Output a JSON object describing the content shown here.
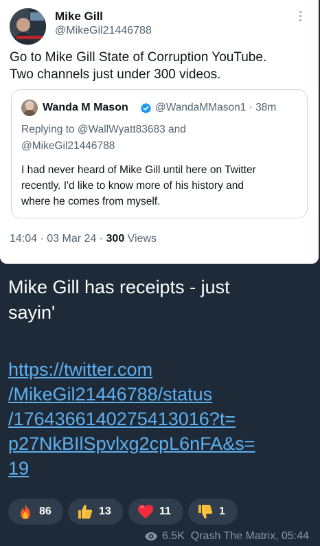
{
  "tweet": {
    "author_name": "Mike Gill",
    "author_handle": "@MikeGil21446788",
    "text_lines": [
      "Go to Mike Gill State of Corruption YouTube.",
      "Two channels just under 300 videos."
    ],
    "quote": {
      "name": "Wanda M Mason",
      "handle_time": "@WandaMMason1 · 38m",
      "reply_line1": "Replying to @WallWyatt83683 and",
      "reply_line2": "@MikeGil21446788",
      "body_lines": [
        "I had never heard of Mike Gill until here on Twitter",
        "recently. I'd like to know more of his history and",
        "where he comes from myself."
      ]
    },
    "time": "14:04 · 03 Mar 24 · ",
    "views_count": "300",
    "views_label": " Views"
  },
  "message": {
    "text_lines": [
      "Mike Gill has receipts - just",
      "sayin'"
    ],
    "link_lines": [
      "https://twitter.com",
      "/MikeGil21446788/status",
      "/1764366140275413016?t=",
      "p27NkBIlSpvlxg2cpL6nFA&s=",
      "19"
    ]
  },
  "reactions": [
    {
      "icon": "fire-icon",
      "count": "86"
    },
    {
      "icon": "thumbs-up-icon",
      "count": "13"
    },
    {
      "icon": "heart-icon",
      "count": "11"
    },
    {
      "icon": "thumbs-down-icon",
      "count": "1"
    }
  ],
  "footer": {
    "views": "6.5K",
    "channel_time": "Qrash The Matrix, 05:44"
  },
  "colors": {
    "background": "#1e2a38",
    "link": "#5eb0f0",
    "reaction_bg": "#2f3d4d",
    "verified": "#1d9bf0"
  }
}
